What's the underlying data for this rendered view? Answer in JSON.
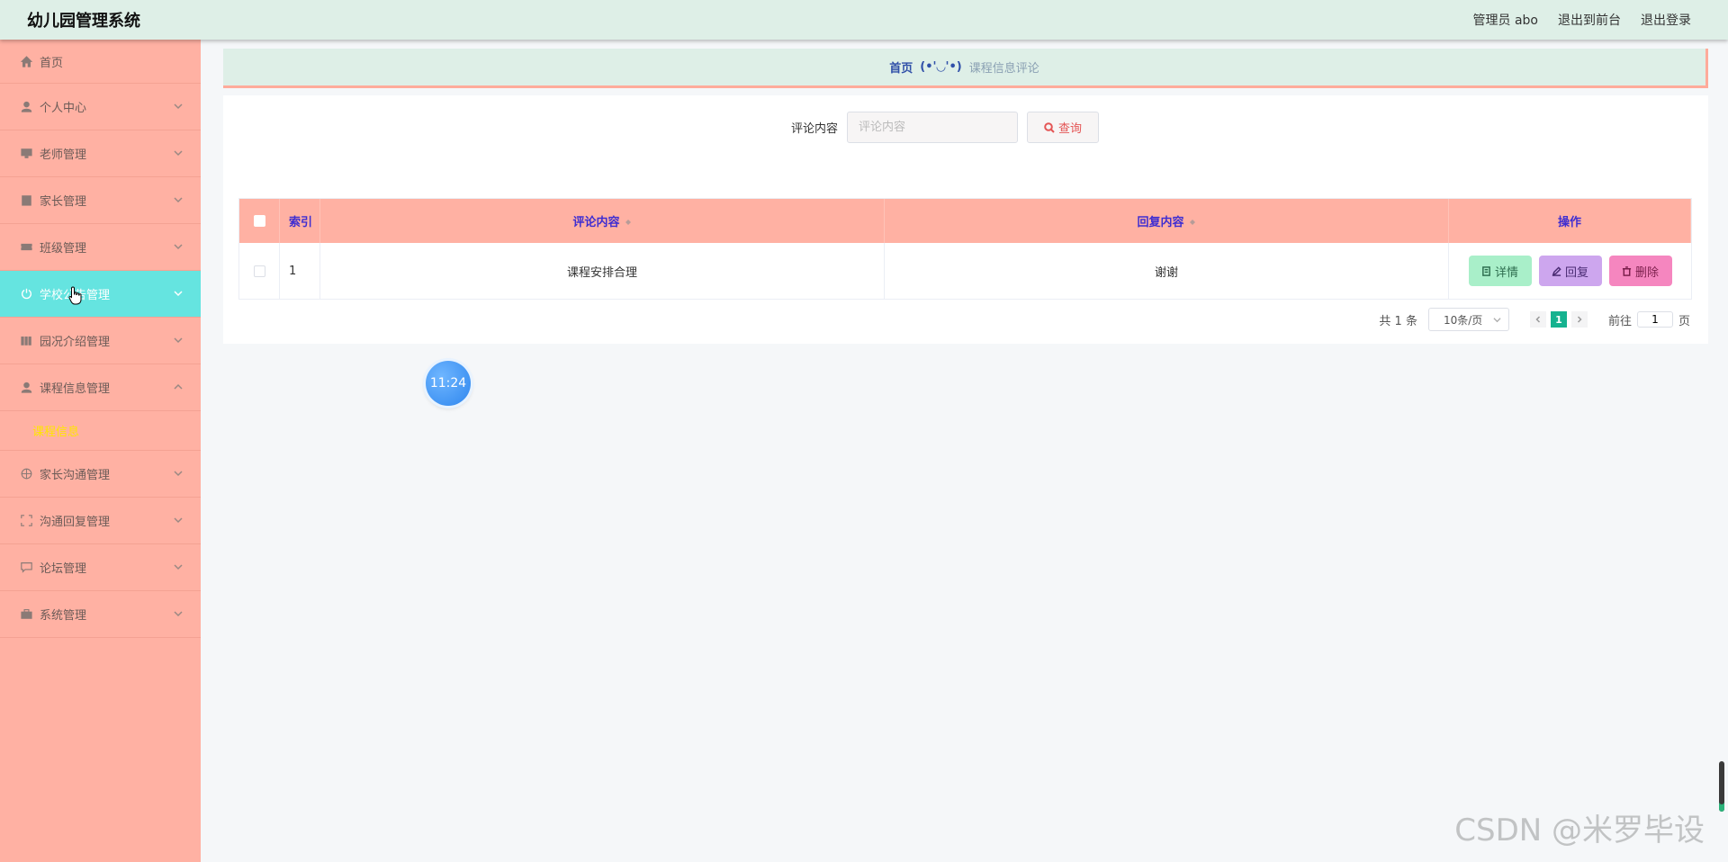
{
  "header": {
    "app_title": "幼儿园管理系统",
    "links": [
      "管理员 abo",
      "退出到前台",
      "退出登录"
    ]
  },
  "sidebar": {
    "items": [
      {
        "label": "首页",
        "icon": "home-icon"
      },
      {
        "label": "个人中心",
        "icon": "user-icon"
      },
      {
        "label": "老师管理",
        "icon": "monitor-icon"
      },
      {
        "label": "家长管理",
        "icon": "clipboard-icon"
      },
      {
        "label": "班级管理",
        "icon": "ticket-icon"
      },
      {
        "label": "学校公告管理",
        "icon": "power-icon"
      },
      {
        "label": "园况介绍管理",
        "icon": "bar-icon"
      },
      {
        "label": "课程信息管理",
        "icon": "person-icon"
      },
      {
        "label": "家长沟通管理",
        "icon": "target-icon"
      },
      {
        "label": "沟通回复管理",
        "icon": "expand-icon"
      },
      {
        "label": "论坛管理",
        "icon": "chat-icon"
      },
      {
        "label": "系统管理",
        "icon": "briefcase-icon"
      }
    ],
    "sub_item": "课程信息"
  },
  "breadcrumb": {
    "home": "首页",
    "separator": "(•'◡'•)",
    "current": "课程信息评论"
  },
  "search": {
    "label": "评论内容",
    "placeholder": "评论内容",
    "button": "查询"
  },
  "table": {
    "headers": {
      "index": "索引",
      "comment": "评论内容",
      "reply": "回复内容",
      "ops": "操作"
    },
    "rows": [
      {
        "index": "1",
        "comment": "课程安排合理",
        "reply": "谢谢"
      }
    ],
    "buttons": {
      "detail": "详情",
      "reply": "回复",
      "delete": "删除"
    }
  },
  "pagination": {
    "total": "共 1 条",
    "page_size": "10条/页",
    "current_page": "1",
    "goto_prefix": "前往",
    "goto_value": "1",
    "goto_suffix": "页"
  },
  "clock": "11:24",
  "watermark": "CSDN @米罗毕设",
  "colors": {
    "header_bg": "#deefe7",
    "sidebar_bg": "#ffb1a3",
    "sidebar_active": "#65e4e0",
    "table_head": "#ffb1a3",
    "detail_btn": "#a9efc9",
    "reply_btn": "#cda6ee",
    "delete_btn": "#f586bf",
    "page_active": "#15b28f"
  }
}
